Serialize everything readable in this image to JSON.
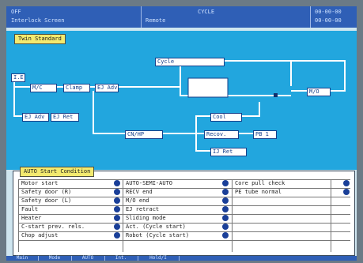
{
  "header": {
    "left_top": "OFF",
    "left_bottom": "Interlock Screen",
    "mid_top": "CYCLE",
    "mid_bottom": "Remote",
    "right_top": "00-00-00",
    "right_bottom": "00-00-00"
  },
  "diagram": {
    "mode_badge": "Twin  Standard",
    "nodes": {
      "cycle": "Cycle",
      "ie": "I.E",
      "mc": "M/C",
      "clamp": "Clamp",
      "ej_adv_top": "EJ Adv",
      "mo": "M/O",
      "ej_adv_left": "EJ Adv",
      "ej_ret_left": "EJ Ret",
      "cn_hp": "CN/HP",
      "cool": "Cool",
      "recov": "Recov.",
      "pb1": "PB 1",
      "ij_ret": "IJ Ret"
    }
  },
  "auto_start": {
    "title": "AUTO Start Condition",
    "col1": [
      "Motor start",
      "Safety door (R)",
      "Safety door (L)",
      "Fault",
      "Heater",
      "C-start prev. rels.",
      "Chop adjust"
    ],
    "col2": [
      "AUTO-SEMI-AUTO",
      "RECV end",
      "M/O end",
      "EJ retract",
      "Sliding mode",
      "Act. (Cycle start)",
      "Robot (Cycle start)"
    ],
    "col3": [
      "Core pull check",
      "PE tube normal",
      "",
      "",
      "",
      "",
      ""
    ],
    "col4": [
      "",
      "",
      "",
      "",
      "",
      "",
      ""
    ]
  },
  "footer": {
    "b1": "Main",
    "b2": "Mode",
    "b3": "AUTO",
    "b4": "Int.",
    "b5": "Hold/I"
  }
}
